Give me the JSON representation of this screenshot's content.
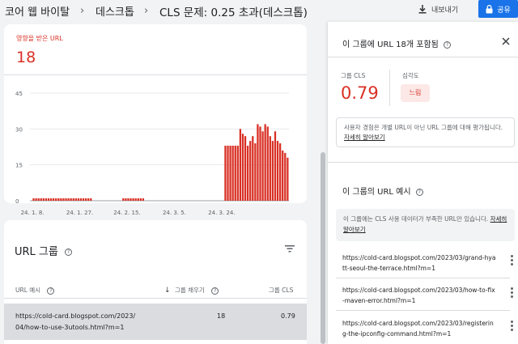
{
  "breadcrumb": {
    "items": [
      "코어 웹 바이탈",
      "데스크톱"
    ],
    "current": "CLS 문제: 0.25 초과(데스크톱)"
  },
  "header": {
    "export_label": "내보내기",
    "share_label": "공유",
    "icons": [
      "download-icon",
      "lock-icon"
    ]
  },
  "metric": {
    "label": "영향을 받은 URL",
    "value": "18"
  },
  "chart_data": {
    "type": "bar",
    "color": "#d93025",
    "y_ticks": [
      "0",
      "15",
      "30",
      "45"
    ],
    "ylim": [
      0,
      45
    ],
    "x_tick_labels": [
      "24. 1. 8.",
      "24. 1. 27.",
      "24. 2. 15.",
      "24. 3. 5.",
      "24. 3. 24."
    ],
    "x_tick_index": [
      1,
      20,
      39,
      58,
      77
    ],
    "values": [
      0,
      1,
      1,
      1,
      1,
      1,
      1,
      1,
      1,
      1,
      1,
      1,
      1,
      1,
      1,
      1,
      1,
      1,
      1,
      1,
      1,
      1,
      1,
      1,
      1,
      0,
      0,
      0,
      0,
      0,
      0,
      0,
      0,
      0,
      0,
      0,
      0,
      1,
      1,
      1,
      1,
      1,
      1,
      1,
      1,
      1,
      0,
      0,
      0,
      0,
      0,
      0,
      0,
      0,
      0,
      0,
      0,
      0,
      0,
      0,
      0,
      0,
      0,
      0,
      0,
      0,
      0,
      0,
      0,
      0,
      0,
      0,
      0,
      0,
      0,
      0,
      0,
      0,
      23,
      23,
      23,
      23,
      23,
      23,
      30,
      28,
      27,
      23,
      25,
      27,
      24,
      32,
      31,
      29,
      32,
      31,
      27,
      25,
      29,
      25,
      24,
      21,
      20,
      18
    ]
  },
  "url_group": {
    "title": "URL 그룹",
    "columns": {
      "url": "URL 예시",
      "count": "그룹 채우기",
      "cls": "그룹 CLS"
    },
    "rows": [
      {
        "url": "https://cold-card.blogspot.com/2023/04/how-to-use-3utools.html?m=1",
        "count": "18",
        "cls": "0.79"
      }
    ]
  },
  "panel": {
    "title": "이 그룹에 URL 18개 포함됨",
    "cls_label": "그룹 CLS",
    "cls_value": "0.79",
    "severity_label": "심각도",
    "severity_value": "느림",
    "info_text": "사용자 경험은 개별 URL이 아닌 URL 그룹에 대해 평가됩니다. ",
    "info_link": "자세히 알아보기",
    "examples_title": "이 그룹의 URL 예시",
    "examples_note": "이 그룹에는 CLS 사용 데이터가 부족한 URL만 있습니다. ",
    "examples_note_link": "자세히 알아보기",
    "examples": [
      "https://cold-card.blogspot.com/2023/03/grand-hyatt-seoul-the-terrace.html?m=1",
      "https://cold-card.blogspot.com/2023/03/how-to-fix-maven-error.html?m=1",
      "https://cold-card.blogspot.com/2023/03/registering-the-ipconfig-command.html?m=1"
    ]
  }
}
